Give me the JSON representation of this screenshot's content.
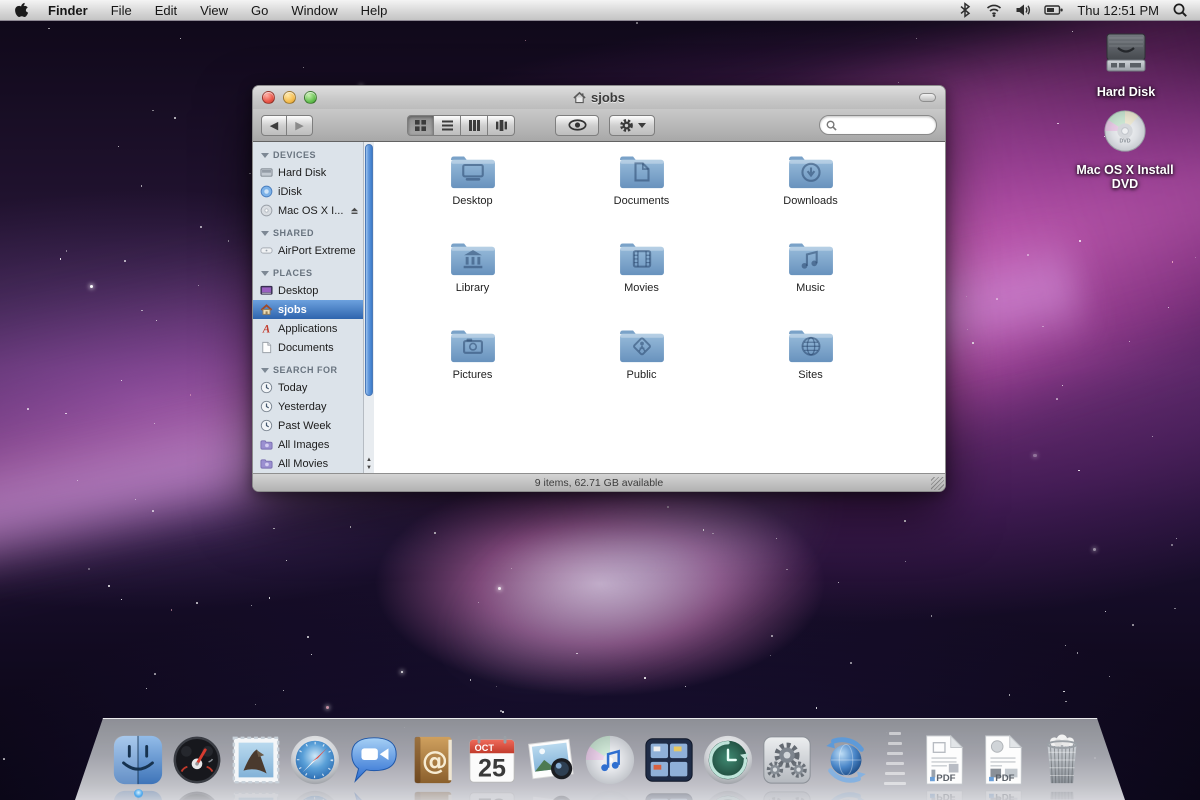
{
  "menu_bar": {
    "menus": [
      "Finder",
      "File",
      "Edit",
      "View",
      "Go",
      "Window",
      "Help"
    ],
    "status_icons": [
      "bluetooth",
      "wifi",
      "volume",
      "battery"
    ],
    "clock": "Thu 12:51 PM"
  },
  "desktop": {
    "icons": [
      {
        "name": "hard-disk",
        "kind": "hard-disk",
        "label": "Hard Disk"
      },
      {
        "name": "install-dvd",
        "kind": "dvd",
        "label": "Mac OS X Install DVD",
        "disc_text": "DVD"
      }
    ]
  },
  "window": {
    "title": "sjobs",
    "toolbar": {
      "view_modes": [
        "icon",
        "list",
        "column",
        "coverflow"
      ],
      "active_view": "icon",
      "search_value": ""
    },
    "sidebar": {
      "sections": [
        {
          "header": "DEVICES",
          "items": [
            {
              "label": "Hard Disk",
              "icon": "hard-disk-mini"
            },
            {
              "label": "iDisk",
              "icon": "idisk"
            },
            {
              "label": "Mac OS X I...",
              "icon": "disc-mini",
              "eject": true
            }
          ]
        },
        {
          "header": "SHARED",
          "items": [
            {
              "label": "AirPort Extreme",
              "icon": "airport"
            }
          ]
        },
        {
          "header": "PLACES",
          "items": [
            {
              "label": "Desktop",
              "icon": "desktop-mini"
            },
            {
              "label": "sjobs",
              "icon": "home",
              "selected": true
            },
            {
              "label": "Applications",
              "icon": "applications"
            },
            {
              "label": "Documents",
              "icon": "doc-mini"
            }
          ]
        },
        {
          "header": "SEARCH FOR",
          "items": [
            {
              "label": "Today",
              "icon": "clock"
            },
            {
              "label": "Yesterday",
              "icon": "clock"
            },
            {
              "label": "Past Week",
              "icon": "clock"
            },
            {
              "label": "All Images",
              "icon": "smart-folder"
            },
            {
              "label": "All Movies",
              "icon": "smart-folder"
            }
          ]
        }
      ]
    },
    "folders": [
      {
        "label": "Desktop",
        "glyph": "desktop"
      },
      {
        "label": "Documents",
        "glyph": "document"
      },
      {
        "label": "Downloads",
        "glyph": "downloads"
      },
      {
        "label": "Library",
        "glyph": "library"
      },
      {
        "label": "Movies",
        "glyph": "movies"
      },
      {
        "label": "Music",
        "glyph": "music"
      },
      {
        "label": "Pictures",
        "glyph": "pictures"
      },
      {
        "label": "Public",
        "glyph": "public"
      },
      {
        "label": "Sites",
        "glyph": "sites"
      }
    ],
    "status_bar": "9 items, 62.71 GB available"
  },
  "dock": {
    "items": [
      {
        "name": "finder",
        "running": true
      },
      {
        "name": "dashboard"
      },
      {
        "name": "mail"
      },
      {
        "name": "safari"
      },
      {
        "name": "ichat"
      },
      {
        "name": "address-book"
      },
      {
        "name": "ical",
        "month": "OCT",
        "day": "25"
      },
      {
        "name": "iphoto"
      },
      {
        "name": "itunes"
      },
      {
        "name": "spaces"
      },
      {
        "name": "time-machine"
      },
      {
        "name": "system-preferences"
      },
      {
        "name": "software-update"
      },
      {
        "name": "separator",
        "separator": true
      },
      {
        "name": "pdf-document-1",
        "badge": "PDF"
      },
      {
        "name": "pdf-document-2",
        "badge": "PDF"
      },
      {
        "name": "trash"
      }
    ]
  },
  "colors": {
    "selection_blue": "#2e64ad",
    "folder_blue": "#6b96c0",
    "menubar_gray": "#d6d6d6"
  }
}
